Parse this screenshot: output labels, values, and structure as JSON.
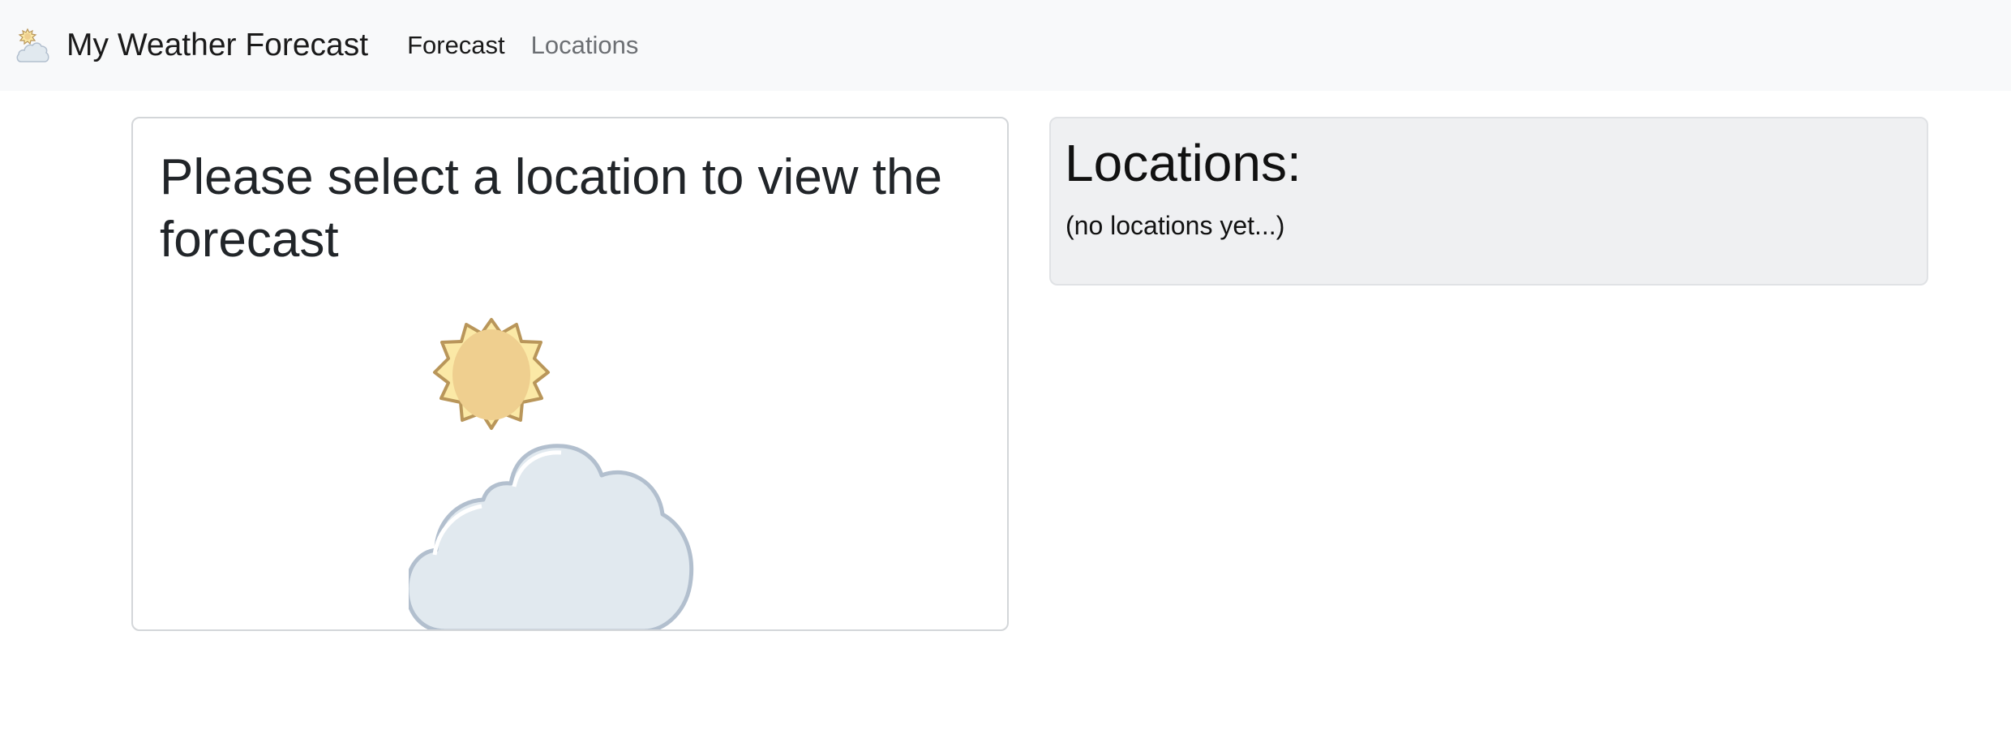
{
  "navbar": {
    "brand_icon": "partly-cloudy-icon",
    "brand_text": "My Weather Forecast",
    "links": [
      {
        "label": "Forecast",
        "active": true
      },
      {
        "label": "Locations",
        "active": false
      }
    ]
  },
  "forecast": {
    "title": "Please select a location to view the forecast",
    "illustration": "partly-cloudy-icon"
  },
  "locations": {
    "heading": "Locations:",
    "empty_text": "(no locations yet...)"
  },
  "colors": {
    "navbar_bg": "#f8f9fa",
    "sun_fill": "#fbe9a6",
    "sun_stroke": "#b9965a",
    "sun_core": "#efcf8f",
    "cloud_fill": "#e1e9ef",
    "cloud_stroke": "#b2bfce",
    "panel_bg": "#eff0f2"
  }
}
